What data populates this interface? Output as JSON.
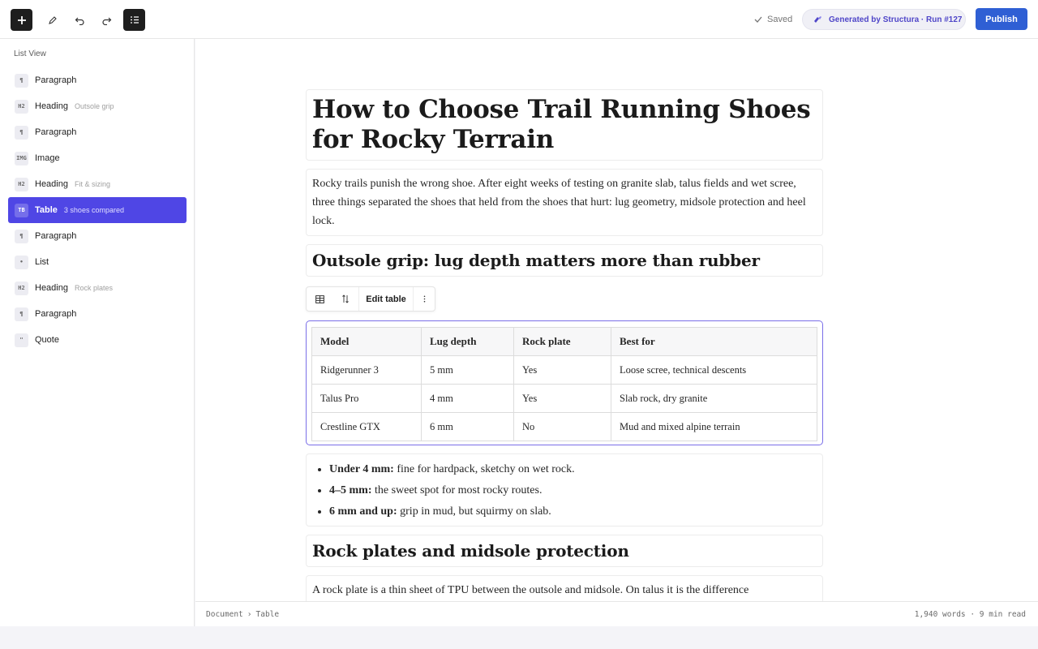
{
  "toolbar": {
    "saved_label": "Saved",
    "generated_label": "Generated by Structura · Run #127",
    "publish_label": "Publish"
  },
  "sidebar": {
    "title": "List View",
    "items": [
      {
        "badge": "¶",
        "name": "Paragraph",
        "sub": ""
      },
      {
        "badge": "H2",
        "name": "Heading",
        "sub": "Outsole grip"
      },
      {
        "badge": "¶",
        "name": "Paragraph",
        "sub": ""
      },
      {
        "badge": "IMG",
        "name": "Image",
        "sub": ""
      },
      {
        "badge": "H2",
        "name": "Heading",
        "sub": "Fit & sizing"
      },
      {
        "badge": "TB",
        "name": "Table",
        "sub": "3 shoes compared"
      },
      {
        "badge": "¶",
        "name": "Paragraph",
        "sub": ""
      },
      {
        "badge": "•",
        "name": "List",
        "sub": ""
      },
      {
        "badge": "H2",
        "name": "Heading",
        "sub": "Rock plates"
      },
      {
        "badge": "¶",
        "name": "Paragraph",
        "sub": ""
      },
      {
        "badge": "\"",
        "name": "Quote",
        "sub": ""
      }
    ]
  },
  "doc": {
    "title": "How to Choose Trail Running Shoes for Rocky Terrain",
    "intro": "Rocky trails punish the wrong shoe. After eight weeks of testing on granite slab, talus fields and wet scree, three things separated the shoes that held from the shoes that hurt: lug geometry, midsole protection and heel lock.",
    "heading1": "Outsole grip: lug depth matters more than rubber",
    "table_toolbar": {
      "edit_label": "Edit table"
    },
    "table": {
      "headers": [
        "Model",
        "Lug depth",
        "Rock plate",
        "Best for"
      ],
      "rows": [
        [
          "Ridgerunner 3",
          "5 mm",
          "Yes",
          "Loose scree, technical descents"
        ],
        [
          "Talus Pro",
          "4 mm",
          "Yes",
          "Slab rock, dry granite"
        ],
        [
          "Crestline GTX",
          "6 mm",
          "No",
          "Mud and mixed alpine terrain"
        ]
      ]
    },
    "list": [
      {
        "bold": "Under 4 mm:",
        "text": " fine for hardpack, sketchy on wet rock."
      },
      {
        "bold": "4–5 mm:",
        "text": " the sweet spot for most rocky routes."
      },
      {
        "bold": "6 mm and up:",
        "text": " grip in mud, but squirmy on slab."
      }
    ],
    "heading2": "Rock plates and midsole protection",
    "para2": "A rock plate is a thin sheet of TPU between the outsole and midsole. On talus it is the difference"
  },
  "status": {
    "crumb_root": "Document",
    "crumb_sep": "›",
    "crumb_current": "Table",
    "word_count": "1,940 words · 9 min read"
  },
  "colors": {
    "accent": "#4f46e5",
    "publish": "#2f5fd4"
  }
}
